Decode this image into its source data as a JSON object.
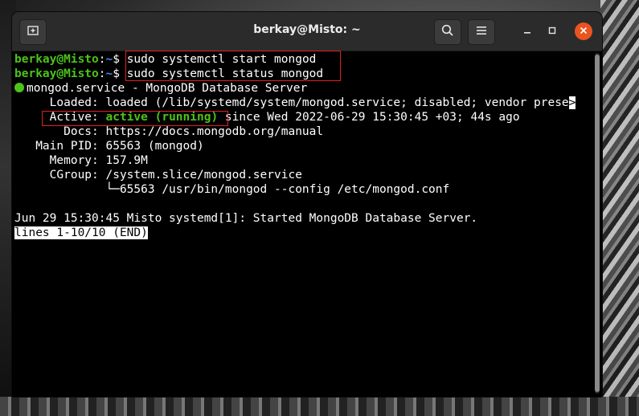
{
  "window": {
    "title": "berkay@Misto: ~",
    "new_tab_icon": "new-tab-icon",
    "search_icon": "search-icon",
    "menu_icon": "hamburger-menu-icon",
    "minimize_icon": "minimize-icon",
    "maximize_icon": "maximize-icon",
    "close_icon": "close-icon",
    "close_color": "#e95420"
  },
  "terminal": {
    "prompt_user": "berkay@Misto",
    "prompt_sep": ":",
    "prompt_path": "~",
    "prompt_char": "$",
    "cmd1": "sudo systemctl start mongod",
    "cmd2": "sudo systemctl status mongod",
    "service_line": "mongod.service - MongoDB Database Server",
    "loaded_line": "     Loaded: loaded (/lib/systemd/system/mongod.service; disabled; vendor prese",
    "loaded_more": ">",
    "active_label": "     Active: ",
    "active_status": "active (running)",
    "active_rest": " since Wed 2022-06-29 15:30:45 +03; 44s ago",
    "docs_line": "       Docs: https://docs.mongodb.org/manual",
    "pid_line": "   Main PID: 65563 (mongod)",
    "memory_line": "     Memory: 157.9M",
    "cgroup_line": "     CGroup: /system.slice/mongod.service",
    "cgroup_child": "             └─65563 /usr/bin/mongod --config /etc/mongod.conf",
    "log_line": "Jun 29 15:30:45 Misto systemd[1]: Started MongoDB Database Server.",
    "pager_line": "lines 1-10/10 (END)",
    "colors": {
      "green": "#4cc319",
      "blue": "#3f8de0",
      "highlight": "#e02020"
    }
  }
}
